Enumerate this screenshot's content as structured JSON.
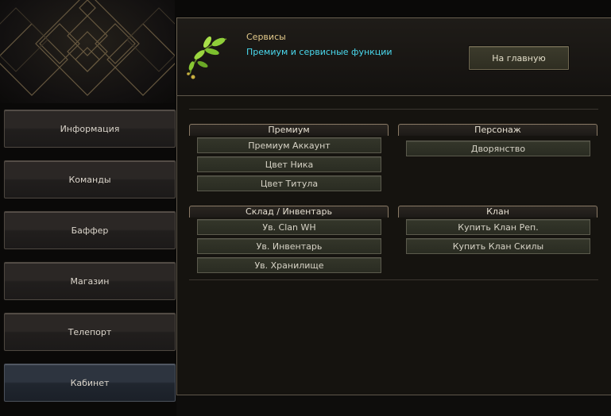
{
  "nav": {
    "items": [
      {
        "label": "Информация"
      },
      {
        "label": "Команды"
      },
      {
        "label": "Баффер"
      },
      {
        "label": "Магазин"
      },
      {
        "label": "Телепорт"
      },
      {
        "label": "Кабинет",
        "active": true
      }
    ]
  },
  "header": {
    "icon": "leaf-icon",
    "title": "Сервисы",
    "subtitle": "Премиум и сервисные функции",
    "home_button": "На главную"
  },
  "sections": {
    "premium": {
      "title": "Премиум",
      "buttons": [
        "Премиум Аккаунт",
        "Цвет Ника",
        "Цвет Титула"
      ]
    },
    "character": {
      "title": "Персонаж",
      "buttons": [
        "Дворянство"
      ]
    },
    "storage": {
      "title": "Склад / Инвентарь",
      "buttons": [
        "Ув. Clan WH",
        "Ув. Инвентарь",
        "Ув. Хранилище"
      ]
    },
    "clan": {
      "title": "Клан",
      "buttons": [
        "Купить Клан Реп.",
        "Купить Клан Скилы"
      ]
    }
  },
  "colors": {
    "title_gold": "#e2c98a",
    "subtitle_cyan": "#4ad9ef",
    "background": "#0a0908"
  }
}
